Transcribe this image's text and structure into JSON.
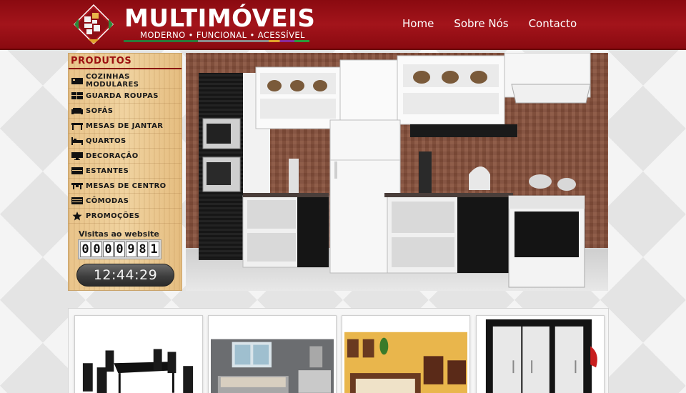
{
  "brand": {
    "name": "MULTIMÓVEIS",
    "tagline": "MODERNO • FUNCIONAL • ACESSÍVEL"
  },
  "nav": {
    "items": [
      {
        "label": "Home"
      },
      {
        "label": "Sobre Nós"
      },
      {
        "label": "Contacto"
      }
    ]
  },
  "sidebar": {
    "title": "PRODUTOS",
    "items": [
      {
        "label": "COZINHAS MODULARES",
        "icon": "kitchen-icon"
      },
      {
        "label": "GUARDA ROUPAS",
        "icon": "wardrobe-icon"
      },
      {
        "label": "SOFÁS",
        "icon": "sofa-icon"
      },
      {
        "label": "MESAS DE JANTAR",
        "icon": "dining-table-icon"
      },
      {
        "label": "QUARTOS",
        "icon": "bed-icon"
      },
      {
        "label": "DECORAÇÃO",
        "icon": "monitor-icon"
      },
      {
        "label": "ESTANTES",
        "icon": "shelf-icon"
      },
      {
        "label": "MESAS DE CENTRO",
        "icon": "coffee-table-icon"
      },
      {
        "label": "CÔMODAS",
        "icon": "dresser-icon"
      },
      {
        "label": "PROMOÇÕES",
        "icon": "star-icon"
      }
    ]
  },
  "visits": {
    "label": "Visitas ao website",
    "digits": [
      "0",
      "0",
      "0",
      "0",
      "9",
      "8",
      "1"
    ]
  },
  "clock": {
    "time": "12:44:29"
  },
  "colors": {
    "header": "#a3141b",
    "accent": "#9c1010"
  }
}
